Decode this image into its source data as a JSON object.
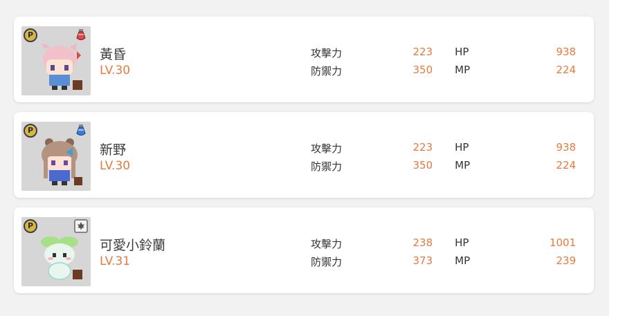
{
  "characters": [
    {
      "name": "黃昏",
      "level": "LV.30",
      "attack_label": "攻擊力",
      "attack": "223",
      "defense_label": "防禦力",
      "defense": "350",
      "hp_label": "HP",
      "hp": "938",
      "mp_label": "MP",
      "mp": "224",
      "badge": "P",
      "corner_icon": "red-potion-icon",
      "sprite": "pink-hair-character"
    },
    {
      "name": "新野",
      "level": "LV.30",
      "attack_label": "攻擊力",
      "attack": "223",
      "defense_label": "防禦力",
      "defense": "350",
      "hp_label": "HP",
      "hp": "938",
      "mp_label": "MP",
      "mp": "224",
      "badge": "P",
      "corner_icon": "blue-potion-icon",
      "sprite": "brown-hair-character"
    },
    {
      "name": "可愛小鈴蘭",
      "level": "LV.31",
      "attack_label": "攻擊力",
      "attack": "238",
      "defense_label": "防禦力",
      "defense": "373",
      "hp_label": "HP",
      "hp": "1001",
      "mp_label": "MP",
      "mp": "239",
      "badge": "P",
      "corner_icon": "maple-leaf-icon",
      "sprite": "green-sprout-character"
    }
  ],
  "colors": {
    "accent": "#e57a3f",
    "text": "#333333",
    "card": "#ffffff",
    "background": "#f2f2f2",
    "avatar_bg": "#d6d6d6"
  }
}
